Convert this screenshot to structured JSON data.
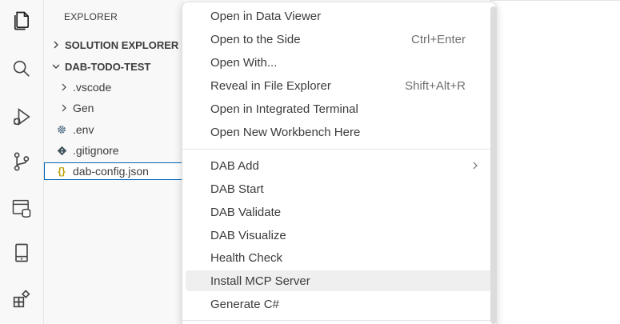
{
  "sidebar": {
    "title": "EXPLORER",
    "sections": [
      {
        "label": "SOLUTION EXPLORER",
        "expanded": false
      },
      {
        "label": "DAB-TODO-TEST",
        "expanded": true
      }
    ],
    "items": [
      {
        "label": ".vscode",
        "type": "folder"
      },
      {
        "label": "Gen",
        "type": "folder"
      },
      {
        "label": ".env",
        "type": "file",
        "icon": "gear-icon"
      },
      {
        "label": ".gitignore",
        "type": "file",
        "icon": "git-icon"
      },
      {
        "label": "dab-config.json",
        "type": "file",
        "icon": "json-braces-icon",
        "selected": true
      }
    ]
  },
  "activity_bar": {
    "icons": [
      "explorer-icon",
      "search-icon",
      "run-debug-icon",
      "source-control-icon",
      "database-icon",
      "device-icon",
      "extensions-icon"
    ]
  },
  "context_menu": {
    "group1": [
      {
        "label": "Open in Data Viewer",
        "shortcut": ""
      },
      {
        "label": "Open to the Side",
        "shortcut": "Ctrl+Enter"
      },
      {
        "label": "Open With...",
        "shortcut": ""
      },
      {
        "label": "Reveal in File Explorer",
        "shortcut": "Shift+Alt+R"
      },
      {
        "label": "Open in Integrated Terminal",
        "shortcut": ""
      },
      {
        "label": "Open New Workbench Here",
        "shortcut": ""
      }
    ],
    "group2": [
      {
        "label": "DAB Add",
        "submenu": true
      },
      {
        "label": "DAB Start"
      },
      {
        "label": "DAB Validate"
      },
      {
        "label": "DAB Visualize"
      },
      {
        "label": "Health Check"
      },
      {
        "label": "Install MCP Server",
        "hovered": true
      },
      {
        "label": "Generate C#"
      }
    ]
  },
  "colors": {
    "selection_border": "#0066b8",
    "json_icon": "#b8a000",
    "hover_bg": "#efefef"
  }
}
